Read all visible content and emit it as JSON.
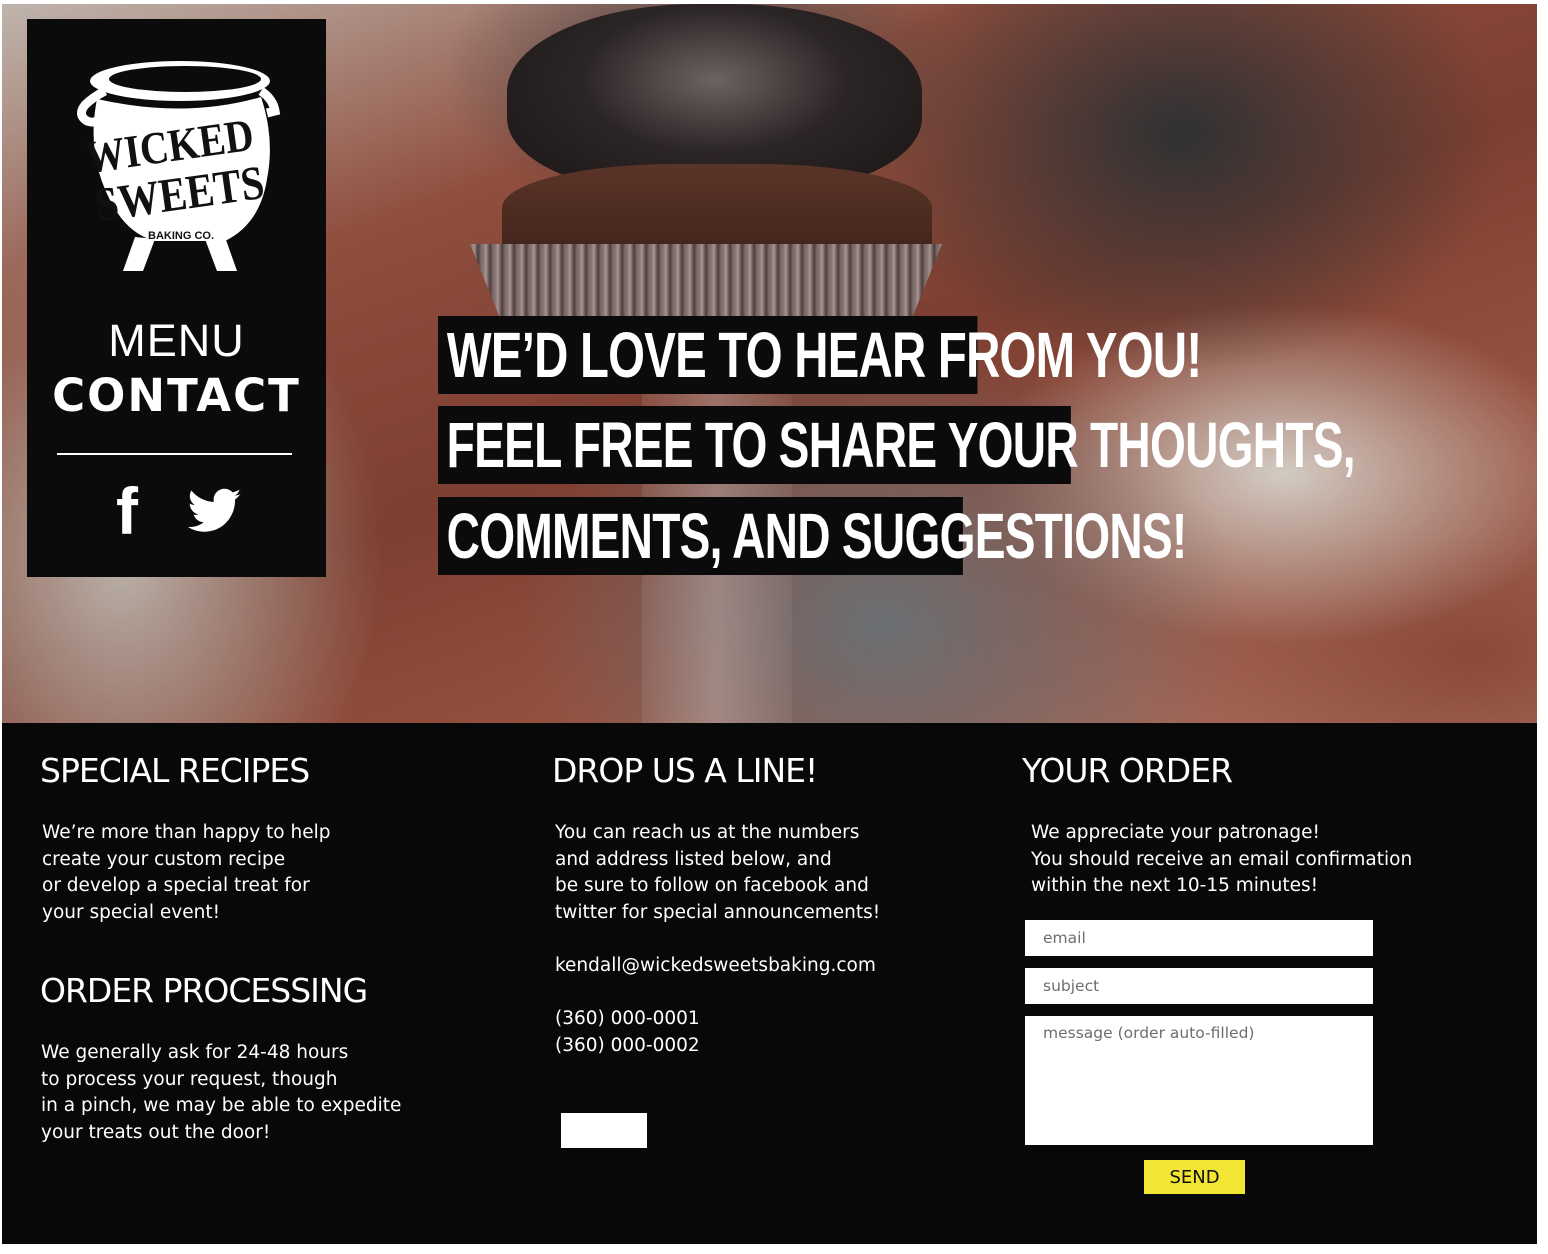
{
  "brand": {
    "logo_text_line1": "WICKED",
    "logo_text_line2": "SWEETS",
    "logo_subtext": "BAKING CO."
  },
  "nav": {
    "menu_label": "MENU",
    "contact_label": "CONTACT",
    "social": [
      {
        "name": "facebook",
        "icon": "facebook-icon",
        "glyph": "f"
      },
      {
        "name": "twitter",
        "icon": "twitter-icon"
      }
    ]
  },
  "hero": {
    "line1": "WE’D LOVE TO HEAR FROM YOU!",
    "line2": "FEEL FREE TO SHARE YOUR THOUGHTS,",
    "line3": "COMMENTS, AND SUGGESTIONS!"
  },
  "special_recipes": {
    "title": "SPECIAL RECIPES",
    "text": "We’re more than happy to help\ncreate your custom recipe\nor develop a special treat for\nyour special event!"
  },
  "order_processing": {
    "title": "ORDER PROCESSING",
    "text": "We generally ask for 24-48 hours\nto process your request, though\nin a pinch, we may be able to expedite\nyour treats out the door!"
  },
  "drop_line": {
    "title": "DROP US A LINE!",
    "text": "You can reach us at the numbers\nand address listed below, and\nbe sure to follow on facebook and\ntwitter for special announcements!",
    "email": "kendall@wickedsweetsbaking.com",
    "phone1": "(360) 000-0001",
    "phone2": "(360) 000-0002"
  },
  "your_order": {
    "title": "YOUR ORDER",
    "text": "We appreciate your patronage!\nYou should receive an email confirmation\nwithin the next 10-15 minutes!",
    "email_placeholder": "email",
    "subject_placeholder": "subject",
    "message_placeholder": "message (order auto-filled)",
    "send_label": "SEND"
  },
  "colors": {
    "background": "#080808",
    "accent_button": "#f2e533",
    "text": "#ffffff"
  }
}
